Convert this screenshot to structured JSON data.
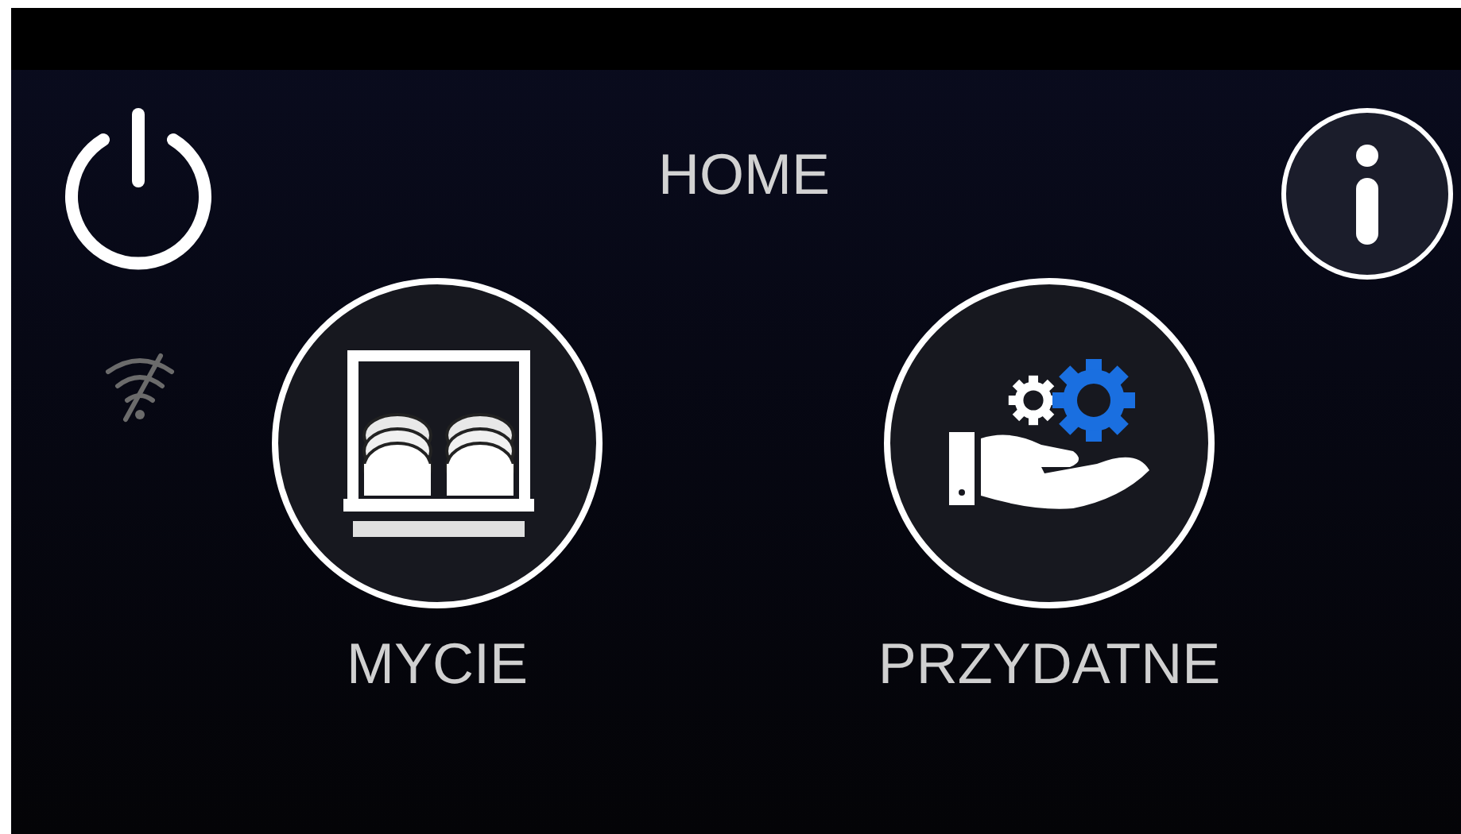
{
  "header": {
    "title": "HOME"
  },
  "tiles": [
    {
      "label": "MYCIE",
      "kind": "dishwasher"
    },
    {
      "label": "PRZYDATNE",
      "kind": "service"
    }
  ]
}
